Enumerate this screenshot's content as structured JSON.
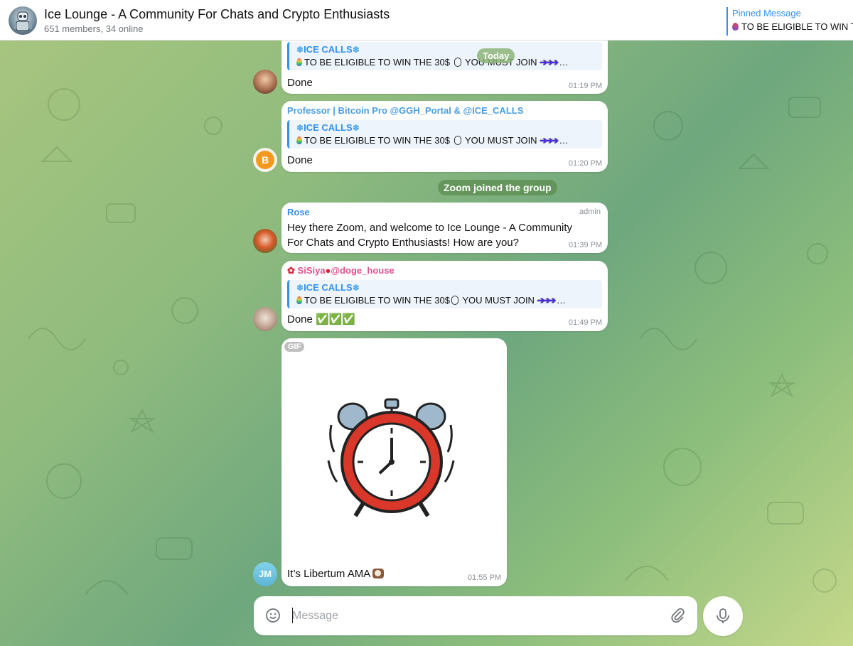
{
  "header": {
    "title": "Ice Lounge - A Community For Chats and Crypto Enthusiasts",
    "subtitle": "651 members, 34 online",
    "pinned_label": "Pinned Message",
    "pinned_text": "TO BE ELIGIBLE TO WIN T"
  },
  "date_badge": "Today",
  "messages": [
    {
      "reply_title": "ICE CALLS",
      "reply_text": "TO BE ELIGIBLE TO WIN THE 30$",
      "reply_tail": "YOU MUST JOIN",
      "text": "Done",
      "time": "01:19 PM"
    },
    {
      "sender": "Professor | Bitcoin Pro @GGH_Portal & @ICE_CALLS",
      "reply_title": "ICE CALLS",
      "reply_text": "TO BE ELIGIBLE TO WIN THE 30$",
      "reply_tail": "YOU MUST JOIN",
      "text": "Done",
      "time": "01:20 PM"
    },
    {
      "service": "Zoom joined the group"
    },
    {
      "sender": "Rose",
      "badge": "admin",
      "text_line1": "Hey there Zoom, and welcome to Ice Lounge - A Community",
      "text_line2": "For Chats and Crypto Enthusiasts! How are you?",
      "time": "01:39 PM"
    },
    {
      "sender": "SiSiya",
      "sender_handle": "@doge_house",
      "reply_title": "ICE CALLS",
      "reply_text": "TO BE ELIGIBLE TO WIN THE 30$",
      "reply_tail": "YOU MUST JOIN",
      "text": "Done",
      "checks": "✅✅✅",
      "time": "01:49 PM"
    },
    {
      "gif_label": "GIF",
      "caption": "It’s Libertum AMA",
      "time": "01:55 PM",
      "avatar_initials": "JM"
    }
  ],
  "composer": {
    "placeholder": "Message"
  },
  "colors": {
    "accent": "#3390ec",
    "rose_sender": "#3390ec",
    "professor_sender": "#4a9ee0",
    "sisiya_sender": "#e0508f",
    "service_bg": "#5c8c50"
  },
  "icons": [
    "group-avatar",
    "emoji-icon",
    "attach-icon",
    "microphone-icon",
    "alarm-clock-gif",
    "snowflake-icon",
    "arrows-icon"
  ]
}
